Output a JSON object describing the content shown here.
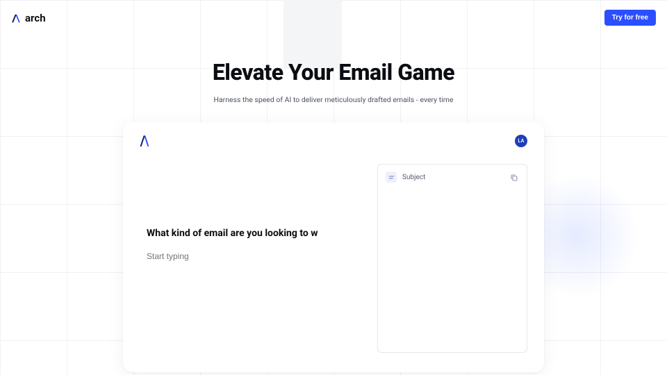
{
  "brand": {
    "name": "arch"
  },
  "cta": {
    "label": "Try for free"
  },
  "hero": {
    "title": "Elevate Your Email Game",
    "subtitle": "Harness the speed of AI to deliver meticulously drafted emails - every time"
  },
  "card": {
    "avatar_initials": "LA",
    "prompt_title": "What kind of email are you looking to w",
    "input_placeholder": "Start typing",
    "subject_label": "Subject"
  }
}
